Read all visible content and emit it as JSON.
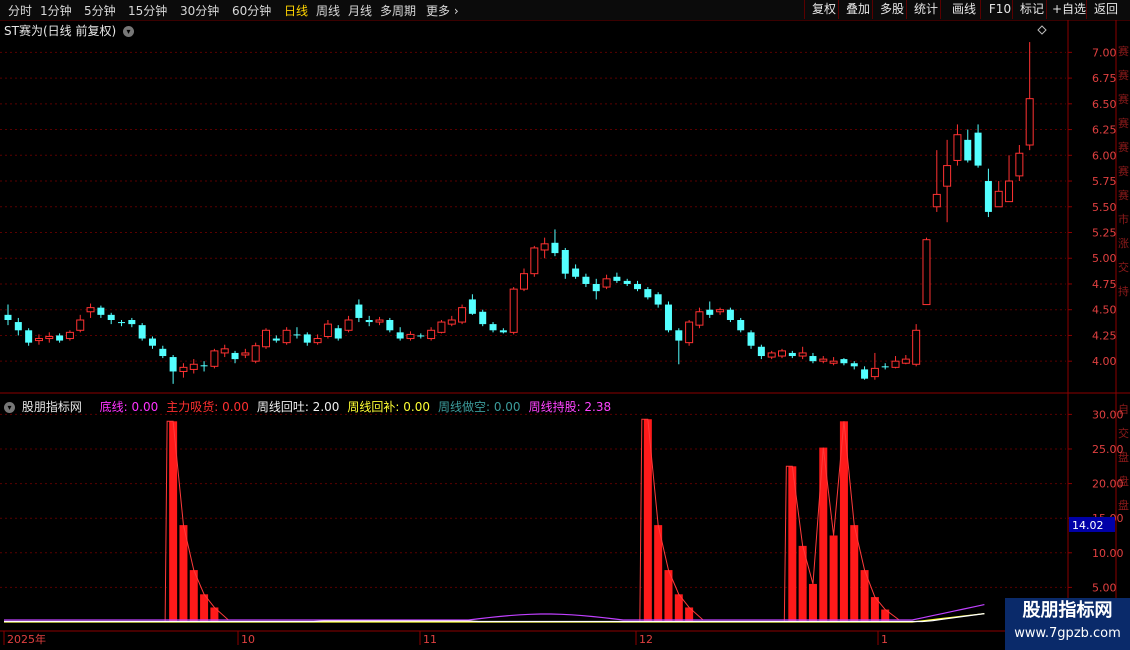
{
  "toolbar": {
    "periods": [
      "分时",
      "1分钟",
      "5分钟",
      "15分钟",
      "30分钟",
      "60分钟",
      "日线",
      "周线",
      "月线",
      "多周期",
      "更多"
    ],
    "active_period": "日线",
    "buttons": [
      "复权",
      "叠加",
      "多股",
      "统计",
      "画线",
      "F10",
      "标记",
      "+自选",
      "返回"
    ]
  },
  "main_chart": {
    "title": "ST赛为(日线 前复权)",
    "y_ticks": [
      "7.00",
      "6.75",
      "6.50",
      "6.25",
      "6.00",
      "5.75",
      "5.50",
      "5.25",
      "5.00",
      "4.75",
      "4.50",
      "4.25",
      "4.00"
    ],
    "y_range": [
      3.72,
      7.12
    ],
    "candles": [
      [
        4.45,
        4.4,
        4.55,
        4.35
      ],
      [
        4.38,
        4.3,
        4.42,
        4.25
      ],
      [
        4.3,
        4.18,
        4.32,
        4.15
      ],
      [
        4.2,
        4.22,
        4.26,
        4.16
      ],
      [
        4.22,
        4.24,
        4.28,
        4.18
      ],
      [
        4.25,
        4.2,
        4.27,
        4.18
      ],
      [
        4.22,
        4.28,
        4.3,
        4.2
      ],
      [
        4.3,
        4.4,
        4.45,
        4.28
      ],
      [
        4.48,
        4.52,
        4.56,
        4.42
      ],
      [
        4.52,
        4.45,
        4.54,
        4.42
      ],
      [
        4.45,
        4.4,
        4.47,
        4.36
      ],
      [
        4.38,
        4.37,
        4.4,
        4.34
      ],
      [
        4.4,
        4.36,
        4.42,
        4.33
      ],
      [
        4.35,
        4.22,
        4.37,
        4.2
      ],
      [
        4.22,
        4.15,
        4.24,
        4.12
      ],
      [
        4.12,
        4.05,
        4.15,
        4.03
      ],
      [
        4.04,
        3.9,
        4.06,
        3.78
      ],
      [
        3.9,
        3.94,
        3.98,
        3.84
      ],
      [
        3.92,
        3.97,
        4.02,
        3.88
      ],
      [
        3.96,
        3.95,
        4.0,
        3.9
      ],
      [
        3.95,
        4.1,
        4.12,
        3.93
      ],
      [
        4.08,
        4.12,
        4.16,
        4.04
      ],
      [
        4.08,
        4.02,
        4.1,
        3.98
      ],
      [
        4.06,
        4.08,
        4.12,
        4.03
      ],
      [
        4.0,
        4.15,
        4.18,
        3.98
      ],
      [
        4.14,
        4.3,
        4.32,
        4.12
      ],
      [
        4.22,
        4.2,
        4.25,
        4.18
      ],
      [
        4.18,
        4.3,
        4.33,
        4.16
      ],
      [
        4.26,
        4.25,
        4.33,
        4.22
      ],
      [
        4.26,
        4.18,
        4.28,
        4.15
      ],
      [
        4.18,
        4.22,
        4.26,
        4.16
      ],
      [
        4.24,
        4.36,
        4.4,
        4.22
      ],
      [
        4.32,
        4.22,
        4.35,
        4.2
      ],
      [
        4.3,
        4.4,
        4.44,
        4.28
      ],
      [
        4.55,
        4.42,
        4.6,
        4.38
      ],
      [
        4.4,
        4.38,
        4.44,
        4.34
      ],
      [
        4.38,
        4.4,
        4.43,
        4.35
      ],
      [
        4.4,
        4.3,
        4.42,
        4.28
      ],
      [
        4.28,
        4.22,
        4.33,
        4.2
      ],
      [
        4.22,
        4.26,
        4.29,
        4.2
      ],
      [
        4.25,
        4.24,
        4.27,
        4.22
      ],
      [
        4.22,
        4.3,
        4.33,
        4.2
      ],
      [
        4.28,
        4.38,
        4.4,
        4.27
      ],
      [
        4.36,
        4.4,
        4.44,
        4.34
      ],
      [
        4.38,
        4.52,
        4.55,
        4.36
      ],
      [
        4.6,
        4.46,
        4.65,
        4.45
      ],
      [
        4.48,
        4.36,
        4.5,
        4.34
      ],
      [
        4.36,
        4.3,
        4.38,
        4.28
      ],
      [
        4.3,
        4.28,
        4.32,
        4.27
      ],
      [
        4.28,
        4.7,
        4.72,
        4.26
      ],
      [
        4.7,
        4.85,
        4.9,
        4.68
      ],
      [
        4.85,
        5.1,
        5.12,
        4.82
      ],
      [
        5.08,
        5.14,
        5.2,
        5.0
      ],
      [
        5.15,
        5.05,
        5.28,
        5.02
      ],
      [
        5.08,
        4.85,
        5.1,
        4.8
      ],
      [
        4.9,
        4.82,
        4.94,
        4.8
      ],
      [
        4.82,
        4.75,
        4.85,
        4.72
      ],
      [
        4.75,
        4.68,
        4.8,
        4.6
      ],
      [
        4.72,
        4.8,
        4.84,
        4.7
      ],
      [
        4.82,
        4.78,
        4.86,
        4.76
      ],
      [
        4.78,
        4.75,
        4.8,
        4.73
      ],
      [
        4.75,
        4.7,
        4.78,
        4.68
      ],
      [
        4.7,
        4.62,
        4.72,
        4.6
      ],
      [
        4.65,
        4.55,
        4.67,
        4.52
      ],
      [
        4.55,
        4.3,
        4.58,
        4.28
      ],
      [
        4.3,
        4.2,
        4.32,
        3.97
      ],
      [
        4.18,
        4.38,
        4.4,
        4.15
      ],
      [
        4.35,
        4.48,
        4.52,
        4.32
      ],
      [
        4.5,
        4.45,
        4.58,
        4.42
      ],
      [
        4.48,
        4.5,
        4.52,
        4.45
      ],
      [
        4.5,
        4.4,
        4.52,
        4.38
      ],
      [
        4.4,
        4.3,
        4.42,
        4.28
      ],
      [
        4.28,
        4.15,
        4.3,
        4.12
      ],
      [
        4.14,
        4.05,
        4.16,
        4.02
      ],
      [
        4.04,
        4.08,
        4.1,
        4.02
      ],
      [
        4.05,
        4.1,
        4.12,
        4.03
      ],
      [
        4.08,
        4.05,
        4.1,
        4.03
      ],
      [
        4.05,
        4.08,
        4.14,
        4.02
      ],
      [
        4.05,
        4.0,
        4.08,
        3.98
      ],
      [
        4.0,
        4.02,
        4.05,
        3.98
      ],
      [
        3.98,
        4.0,
        4.04,
        3.96
      ],
      [
        4.02,
        3.98,
        4.03,
        3.96
      ],
      [
        3.98,
        3.95,
        4.0,
        3.92
      ],
      [
        3.92,
        3.83,
        3.95,
        3.82
      ],
      [
        3.85,
        3.93,
        4.08,
        3.82
      ],
      [
        3.95,
        3.94,
        3.98,
        3.92
      ],
      [
        3.94,
        4.0,
        4.05,
        3.93
      ],
      [
        3.98,
        4.02,
        4.06,
        3.97
      ],
      [
        3.97,
        4.3,
        4.36,
        3.95
      ],
      [
        4.55,
        5.18,
        5.2,
        4.55
      ],
      [
        5.5,
        5.62,
        6.05,
        5.45
      ],
      [
        5.7,
        5.9,
        6.15,
        5.35
      ],
      [
        5.95,
        6.2,
        6.3,
        5.9
      ],
      [
        6.15,
        5.95,
        6.25,
        5.93
      ],
      [
        6.22,
        5.9,
        6.3,
        5.88
      ],
      [
        5.75,
        5.45,
        5.87,
        5.4
      ],
      [
        5.5,
        5.65,
        5.75,
        5.5
      ],
      [
        5.55,
        5.75,
        6.0,
        5.55
      ],
      [
        5.8,
        6.02,
        6.1,
        5.75
      ],
      [
        6.1,
        6.55,
        7.1,
        6.05
      ]
    ]
  },
  "indicator": {
    "name": "股朋指标网",
    "fields": [
      {
        "label": "底线:",
        "value": "0.00",
        "color": "#ff33ff"
      },
      {
        "label": "主力吸货:",
        "value": "0.00",
        "color": "#ff3030"
      },
      {
        "label": "周线回吐:",
        "value": "2.00",
        "color": "#f0f0f0"
      },
      {
        "label": "周线回补:",
        "value": "0.00",
        "color": "#ffff33"
      },
      {
        "label": "周线做空:",
        "value": "0.00",
        "color": "#3c9c9c"
      },
      {
        "label": "周线持股:",
        "value": "2.38",
        "color": "#ff44ff"
      }
    ],
    "y_ticks": [
      "30.00",
      "25.00",
      "20.00",
      "15.00",
      "10.00",
      "5.00"
    ],
    "y_range": [
      0,
      31.5
    ],
    "current_value": "14.02",
    "bars": [
      {
        "i": 16,
        "v": 29
      },
      {
        "i": 17,
        "v": 14
      },
      {
        "i": 18,
        "v": 7.5
      },
      {
        "i": 19,
        "v": 4
      },
      {
        "i": 20,
        "v": 2.1
      },
      {
        "i": 62,
        "v": 29.3
      },
      {
        "i": 63,
        "v": 14
      },
      {
        "i": 64,
        "v": 7.5
      },
      {
        "i": 65,
        "v": 4
      },
      {
        "i": 66,
        "v": 2.1
      },
      {
        "i": 76,
        "v": 22.5
      },
      {
        "i": 77,
        "v": 11
      },
      {
        "i": 78,
        "v": 5.5
      },
      {
        "i": 79,
        "v": 25.2
      },
      {
        "i": 80,
        "v": 12.5
      },
      {
        "i": 81,
        "v": 29
      },
      {
        "i": 82,
        "v": 14
      },
      {
        "i": 83,
        "v": 7.5
      },
      {
        "i": 84,
        "v": 3.6
      },
      {
        "i": 85,
        "v": 1.8
      }
    ],
    "date_labels": [
      "2025年",
      "10",
      "11",
      "12",
      "1"
    ]
  },
  "watermark": {
    "line1": "股朋指标网",
    "line2": "www.7gpzb.com"
  },
  "side_labels_top": [
    "赛",
    "赛",
    "赛",
    "赛",
    "赛",
    "赛",
    "赛",
    "市",
    "涨",
    "交",
    "持"
  ],
  "side_labels_bottom": [
    "自",
    "交",
    "盘",
    "盘",
    "盘"
  ]
}
